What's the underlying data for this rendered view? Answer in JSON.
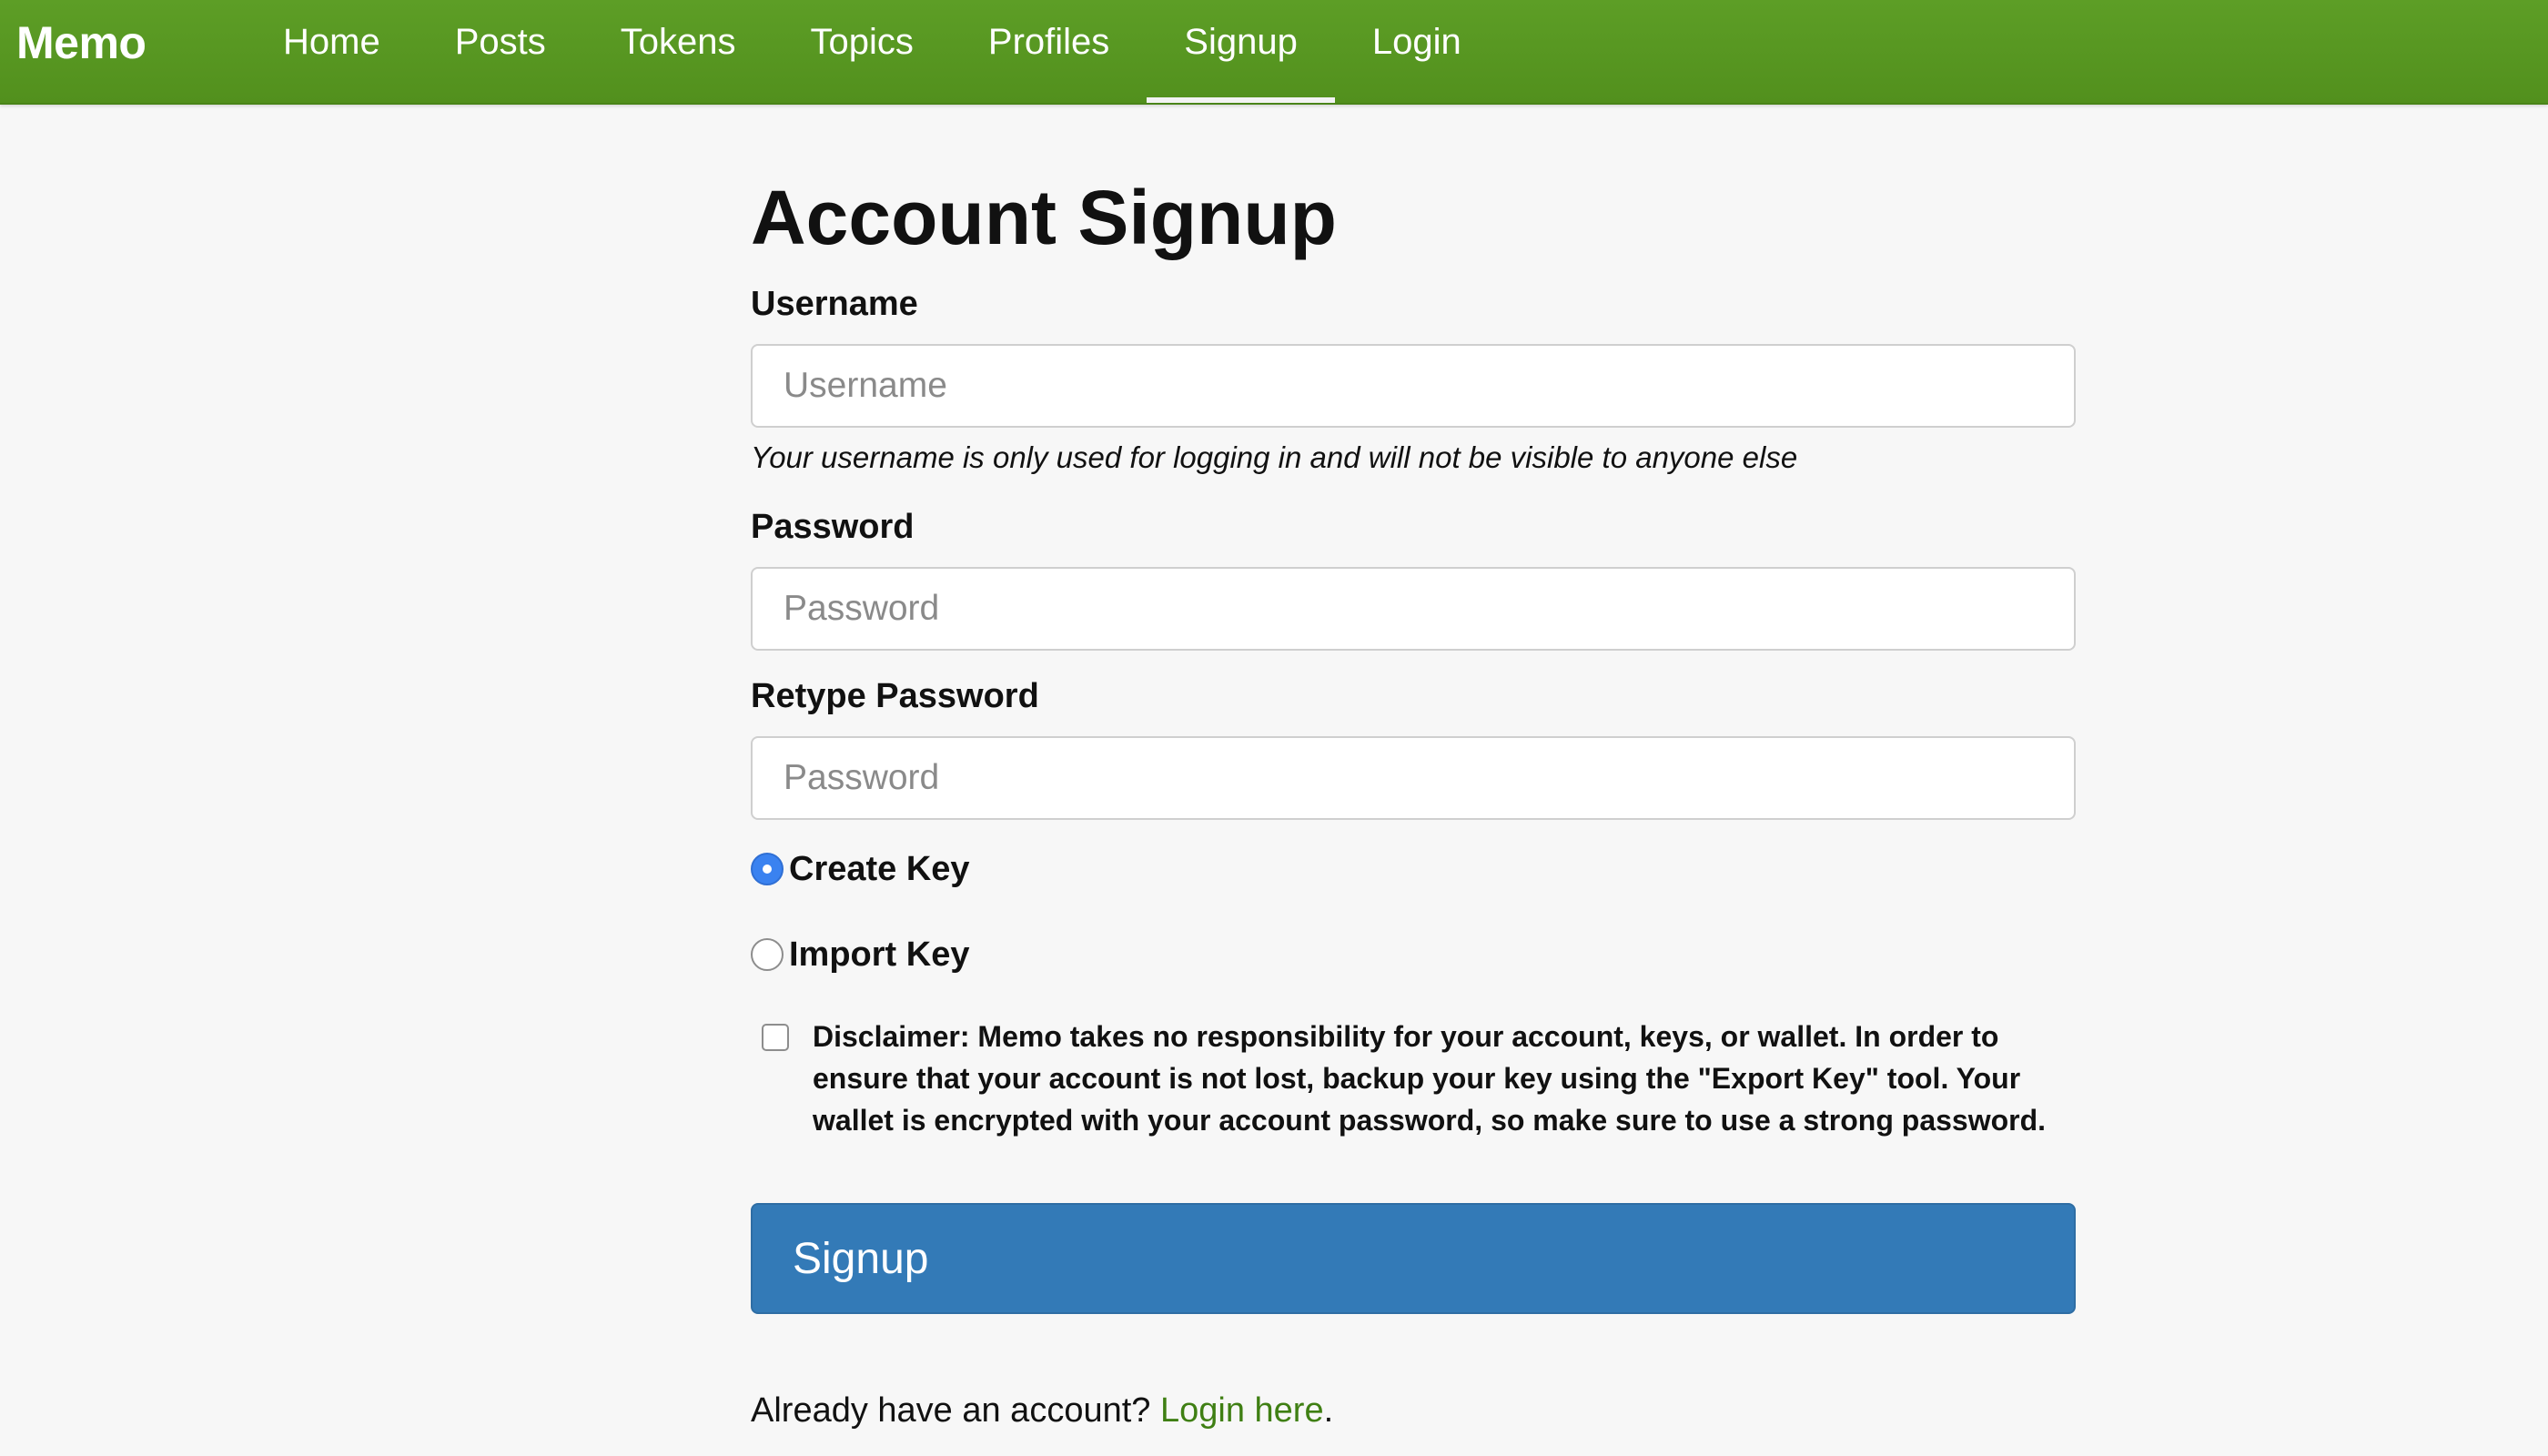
{
  "navbar": {
    "brand": "Memo",
    "items": [
      {
        "label": "Home",
        "active": false
      },
      {
        "label": "Posts",
        "active": false
      },
      {
        "label": "Tokens",
        "active": false
      },
      {
        "label": "Topics",
        "active": false
      },
      {
        "label": "Profiles",
        "active": false
      },
      {
        "label": "Signup",
        "active": true
      },
      {
        "label": "Login",
        "active": false
      }
    ]
  },
  "form": {
    "title": "Account Signup",
    "username_label": "Username",
    "username_placeholder": "Username",
    "username_value": "",
    "username_help": "Your username is only used for logging in and will not be visible to anyone else",
    "password_label": "Password",
    "password_placeholder": "Password",
    "password_value": "",
    "retype_label": "Retype Password",
    "retype_placeholder": "Password",
    "retype_value": "",
    "key_options": [
      {
        "label": "Create Key",
        "checked": true
      },
      {
        "label": "Import Key",
        "checked": false
      }
    ],
    "disclaimer_checked": false,
    "disclaimer": "Disclaimer: Memo takes no responsibility for your account, keys, or wallet. In order to ensure that your account is not lost, backup your key using the \"Export Key\" tool. Your wallet is encrypted with your account password, so make sure to use a strong password.",
    "submit_label": "Signup",
    "already_text": "Already have an account?",
    "login_link": "Login here",
    "already_suffix": "."
  },
  "colors": {
    "navbar": "#55951f",
    "primary_button": "#337ab7",
    "link": "#3f7f13",
    "radio_checked": "#3a82f0",
    "page_background": "#f7f7f7"
  }
}
